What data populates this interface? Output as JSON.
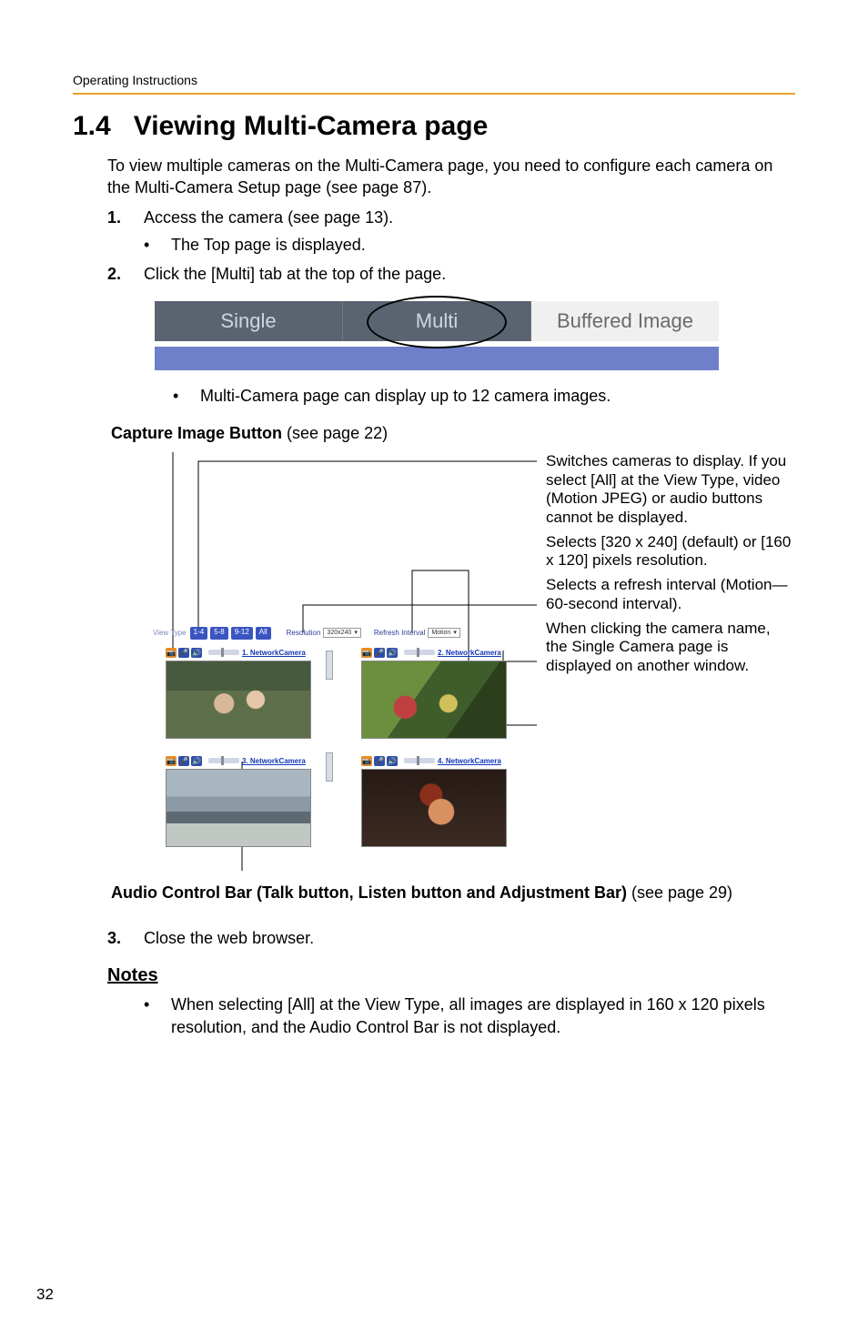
{
  "header": "Operating Instructions",
  "section": {
    "number": "1.4",
    "title": "Viewing Multi-Camera page"
  },
  "intro": "To view multiple cameras on the Multi-Camera page, you need to configure each camera on the Multi-Camera Setup page (see page 87).",
  "steps": {
    "s1": {
      "num": "1.",
      "text": "Access the camera (see page 13)."
    },
    "s1_sub": "The Top page is displayed.",
    "s2": {
      "num": "2.",
      "text": "Click the [Multi] tab at the top of the page."
    },
    "s2_bullet": "Multi-Camera page can display up to 12 camera images.",
    "s3": {
      "num": "3.",
      "text": "Close the web browser."
    }
  },
  "tabs": {
    "single": "Single",
    "multi": "Multi",
    "buffered": "Buffered Image"
  },
  "capture_caption": {
    "bold": "Capture Image Button",
    "rest": " (see page 22)"
  },
  "multiview": {
    "view_type_label": "View Type",
    "buttons": {
      "b1": "1-4",
      "b2": "5-8",
      "b3": "9-12",
      "b4": "All"
    },
    "resolution_label": "Resolution",
    "resolution_value": "320x240",
    "refresh_label": "Refresh Interval",
    "refresh_value": "Motion",
    "cameras": {
      "c1": "1. NetworkCamera",
      "c2": "2. NetworkCamera",
      "c3": "3. NetworkCamera",
      "c4": "4. NetworkCamera"
    }
  },
  "callouts": {
    "c1": "Switches cameras to display. If you select [All] at the View Type, video (Motion JPEG) or audio buttons cannot be displayed.",
    "c2": "Selects [320 x 240] (default) or [160 x 120] pixels resolution.",
    "c3": "Selects a refresh interval (Motion—60-second interval).",
    "c4": "When clicking the camera name, the Single Camera page is displayed on another window."
  },
  "audio_caption": {
    "bold": "Audio Control Bar (Talk button, Listen button and Adjustment Bar)",
    "rest": " (see page 29)"
  },
  "notes": {
    "heading": "Notes",
    "n1": "When selecting [All] at the View Type, all images are displayed in 160 x 120 pixels resolution, and the Audio Control Bar is not displayed."
  },
  "page_number": "32"
}
